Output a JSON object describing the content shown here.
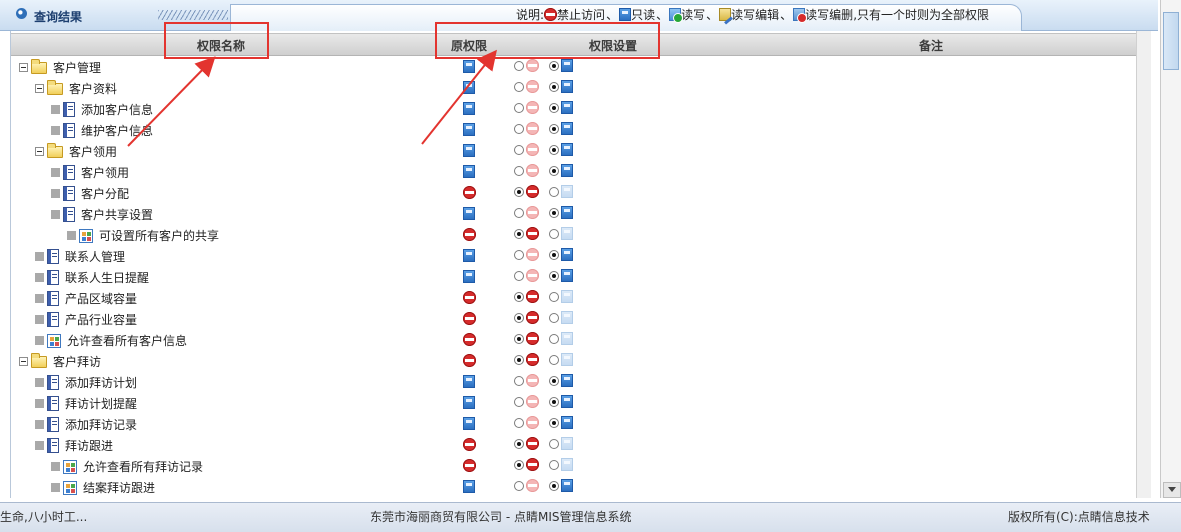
{
  "titlebar": {
    "title": "查询结果",
    "legend": {
      "prefix": "说明:",
      "deny": "禁止访问",
      "read": "只读",
      "rw": "读写",
      "rwe": "读写编辑",
      "rwd": "读写编删",
      "note": ",只有一个时则为全部权限"
    }
  },
  "grid": {
    "columns": {
      "name": "权限名称",
      "orig": "原权限",
      "setting": "权限设置",
      "remark": "备注"
    },
    "rows": [
      {
        "label": "客户管理",
        "orig": "read",
        "set": "read"
      },
      {
        "label": "客户资料",
        "orig": "read",
        "set": "read"
      },
      {
        "label": "添加客户信息",
        "orig": "read",
        "set": "read"
      },
      {
        "label": "维护客户信息",
        "orig": "read",
        "set": "read"
      },
      {
        "label": "客户领用",
        "orig": "read",
        "set": "read"
      },
      {
        "label": "客户领用",
        "orig": "read",
        "set": "read"
      },
      {
        "label": "客户分配",
        "orig": "deny",
        "set": "deny"
      },
      {
        "label": "客户共享设置",
        "orig": "read",
        "set": "read"
      },
      {
        "label": "可设置所有客户的共享",
        "orig": "deny",
        "set": "deny"
      },
      {
        "label": "联系人管理",
        "orig": "read",
        "set": "read"
      },
      {
        "label": "联系人生日提醒",
        "orig": "read",
        "set": "read"
      },
      {
        "label": "产品区域容量",
        "orig": "deny",
        "set": "deny"
      },
      {
        "label": "产品行业容量",
        "orig": "deny",
        "set": "deny"
      },
      {
        "label": "允许查看所有客户信息",
        "orig": "deny",
        "set": "deny"
      },
      {
        "label": "客户拜访",
        "orig": "deny",
        "set": "deny"
      },
      {
        "label": "添加拜访计划",
        "orig": "read",
        "set": "read"
      },
      {
        "label": "拜访计划提醒",
        "orig": "read",
        "set": "read"
      },
      {
        "label": "添加拜访记录",
        "orig": "read",
        "set": "read"
      },
      {
        "label": "拜访跟进",
        "orig": "deny",
        "set": "deny"
      },
      {
        "label": "允许查看所有拜访记录",
        "orig": "deny",
        "set": "deny"
      },
      {
        "label": "结案拜访跟进",
        "orig": "read",
        "set": "read"
      }
    ]
  },
  "footer": {
    "left": "生命,八小时工...",
    "middle": "东莞市海丽商贸有限公司 - 点睛MIS管理信息系统",
    "right": "版权所有(C):点睛信息技术"
  },
  "colors": {
    "annotation": "#e3342f",
    "header_bg": "#d6d6d6",
    "titlebar_bg": "#c9dcf0"
  }
}
